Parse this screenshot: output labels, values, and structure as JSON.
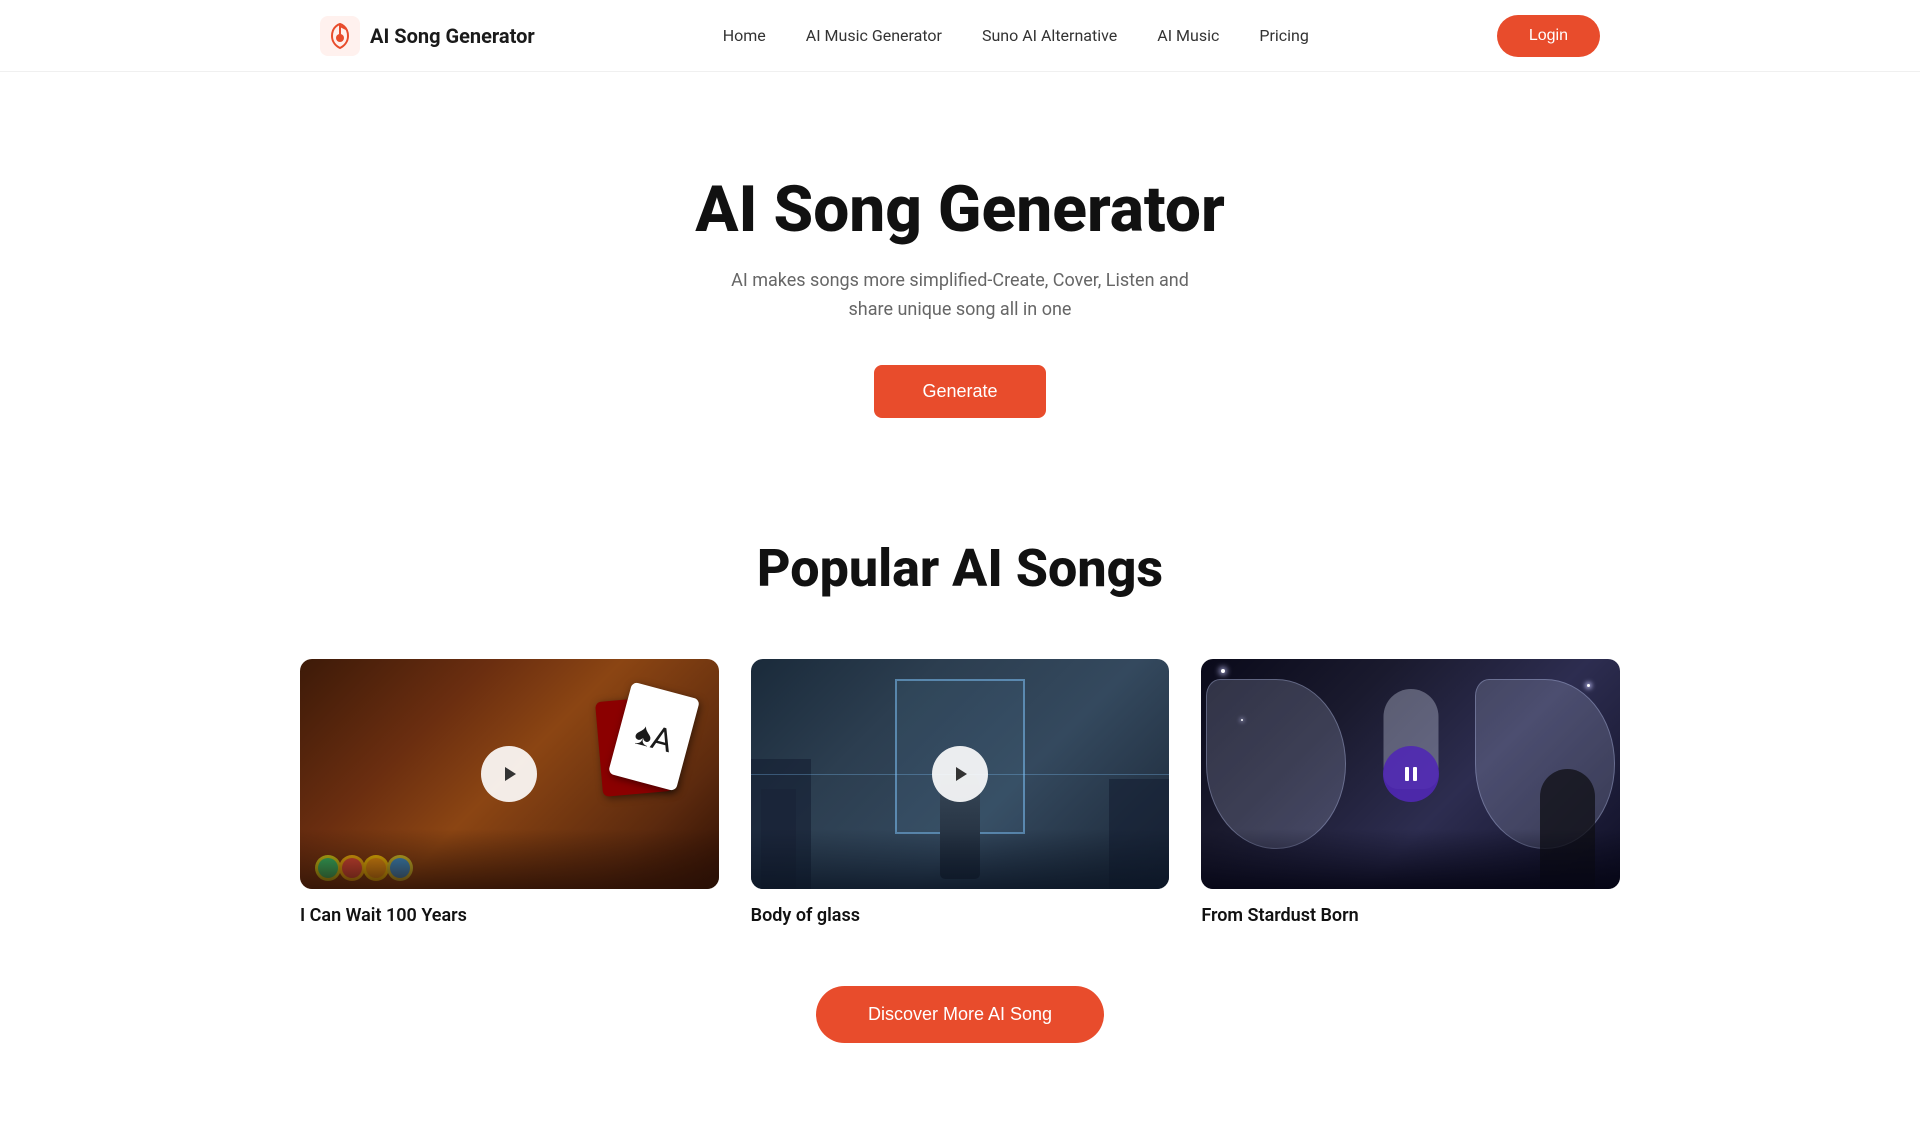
{
  "brand": {
    "name": "AI Song Generator",
    "logo_alt": "AI Song Generator Logo"
  },
  "nav": {
    "links": [
      {
        "label": "Home",
        "href": "#"
      },
      {
        "label": "AI Music Generator",
        "href": "#"
      },
      {
        "label": "Suno AI Alternative",
        "href": "#"
      },
      {
        "label": "AI Music",
        "href": "#"
      },
      {
        "label": "Pricing",
        "href": "#"
      }
    ],
    "login_label": "Login"
  },
  "hero": {
    "title": "AI Song Generator",
    "subtitle": "AI makes songs more simplified-Create, Cover, Listen and\nshare unique song all in one",
    "generate_label": "Generate"
  },
  "popular": {
    "section_title": "Popular AI Songs",
    "songs": [
      {
        "id": "song-1",
        "title": "I Can Wait 100 Years",
        "theme": "casino"
      },
      {
        "id": "song-2",
        "title": "Body of glass",
        "theme": "urban"
      },
      {
        "id": "song-3",
        "title": "From Stardust Born",
        "theme": "fantasy"
      }
    ],
    "discover_label": "Discover More AI Song"
  },
  "colors": {
    "accent": "#e84c2c",
    "accent_purple": "#5a32b0",
    "text_primary": "#111111",
    "text_secondary": "#666666"
  }
}
